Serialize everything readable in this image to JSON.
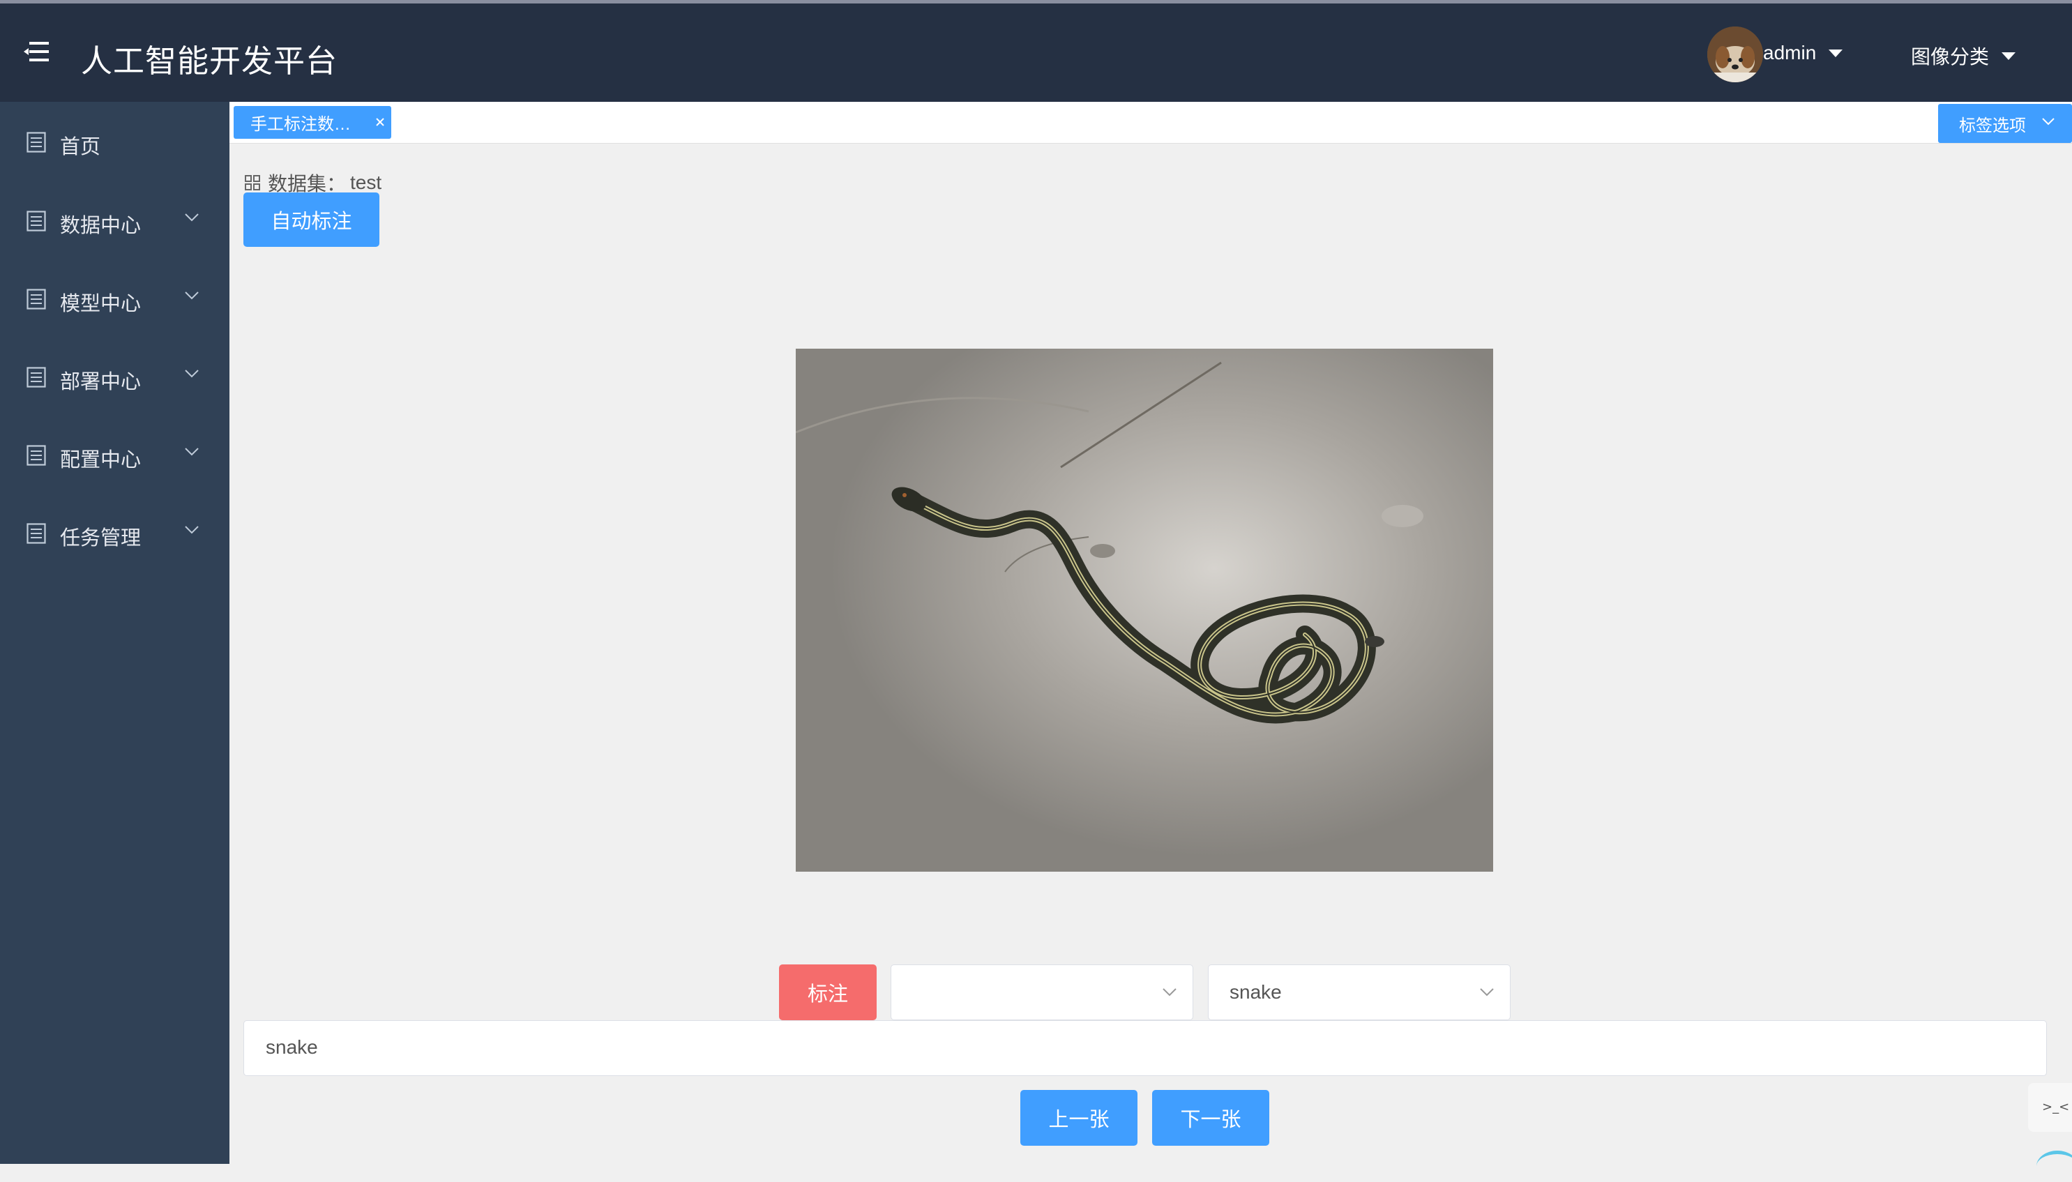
{
  "header": {
    "app_title": "人工智能开发平台",
    "user_name": "admin",
    "module_name": "图像分类"
  },
  "sidebar": {
    "items": [
      {
        "label": "首页",
        "expandable": false
      },
      {
        "label": "数据中心",
        "expandable": true
      },
      {
        "label": "模型中心",
        "expandable": true
      },
      {
        "label": "部署中心",
        "expandable": true
      },
      {
        "label": "配置中心",
        "expandable": true
      },
      {
        "label": "任务管理",
        "expandable": true
      }
    ]
  },
  "tabs": {
    "active_label": "手工标注数…",
    "options_label": "标签选项"
  },
  "main": {
    "dataset_label": "数据集：",
    "dataset_value": "test",
    "auto_label_button": "自动标注",
    "mark_button": "标注",
    "select_one_value": "",
    "select_two_value": "snake",
    "result_value": "snake",
    "prev_button": "上一张",
    "next_button": "下一张"
  },
  "colors": {
    "header_bg": "#253043",
    "sidebar_bg": "#304156",
    "primary": "#409eff",
    "danger": "#f56c6c"
  },
  "icons": {
    "menu_toggle": "hamburger-icon",
    "nav_item": "list-icon",
    "expand": "chevron-down-icon",
    "close_tab": "close-icon",
    "dataset": "grid-icon"
  }
}
